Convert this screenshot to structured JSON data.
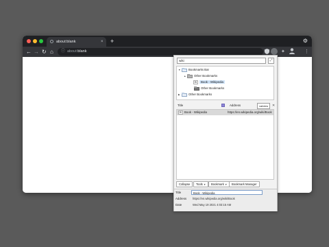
{
  "browser": {
    "tab_title": "about:blank",
    "new_tab_label": "+",
    "tab_close": "×",
    "url_scheme": "about:",
    "url_path": "blank",
    "nav": {
      "back": "←",
      "forward": "→",
      "reload": "↻",
      "home": "⌂"
    },
    "icons": {
      "info": "ⓘ",
      "extensions": "✦",
      "settings": "⚙",
      "menu": "⋮"
    },
    "colors": {
      "close": "#ff5f57",
      "minimize": "#febc2e",
      "maximize": "#28c840"
    }
  },
  "bookmarks_panel": {
    "search_value": "wiki",
    "tree": [
      {
        "label": "Bookmarks Bar",
        "toggle": "▼"
      },
      {
        "label": "Other Bookmarks",
        "toggle": "▲"
      },
      {
        "label": "Book - Wikipedia",
        "badge": "W"
      },
      {
        "label": "Other Bookmarks",
        "toggle": ""
      },
      {
        "label": "Other Bookmarks",
        "toggle": "▶"
      }
    ],
    "list": {
      "title_header": "Title",
      "address_header": "Address",
      "view_button": "valview",
      "close": "✕",
      "rows": [
        {
          "badge": "W",
          "title": "Book - Wikipedia",
          "address": "https://en.wikipedia.org/wiki/Book"
        }
      ]
    },
    "buttons": {
      "collapse": "Collapse",
      "tools": "Tools",
      "bookmark": "Bookmark",
      "manager": "Bookmark Manager",
      "caret": "▾"
    },
    "details": {
      "title_label": "Title",
      "title_value": "Book - Wikipedia",
      "address_label": "Address",
      "address_value": "https://en.wikipedia.org/wiki/Book",
      "date_label": "Date",
      "date_value": "Wed May 19 2021 4:03:15 AM"
    }
  }
}
